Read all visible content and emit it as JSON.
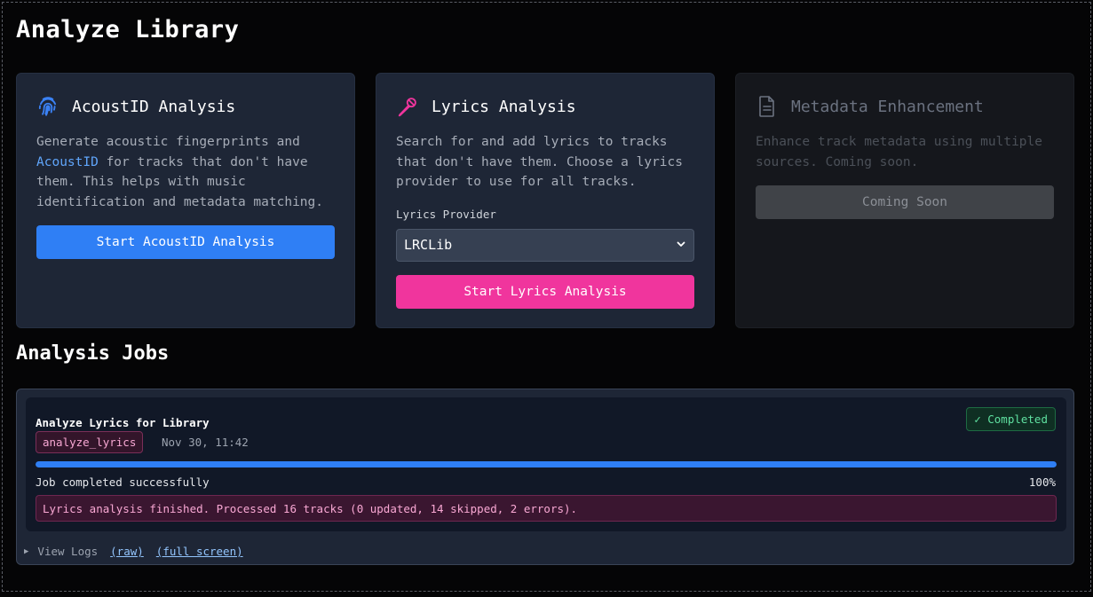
{
  "page": {
    "title": "Analyze Library"
  },
  "cards": {
    "acoustid": {
      "icon": "fingerprint-icon",
      "title": "AcoustID Analysis",
      "desc_before": "Generate acoustic fingerprints and ",
      "desc_highlight": "AcoustID",
      "desc_after": " for tracks that don't have them. This helps with music identification and metadata matching.",
      "button": "Start AcoustID Analysis"
    },
    "lyrics": {
      "icon": "microphone-icon",
      "title": "Lyrics Analysis",
      "desc": "Search for and add lyrics to tracks that don't have them. Choose a lyrics provider to use for all tracks.",
      "provider_label": "Lyrics Provider",
      "provider_value": "LRCLib",
      "button": "Start Lyrics Analysis"
    },
    "metadata": {
      "icon": "document-icon",
      "title": "Metadata Enhancement",
      "desc": "Enhance track metadata using multiple sources. Coming soon.",
      "button": "Coming Soon"
    }
  },
  "jobs": {
    "section_title": "Analysis Jobs",
    "items": [
      {
        "title": "Analyze Lyrics for Library",
        "status": "✓ Completed",
        "type": "analyze_lyrics",
        "time": "Nov 30, 11:42",
        "progress": 100,
        "message": "Job completed successfully",
        "percent": "100%",
        "result": "Lyrics analysis finished. Processed 16 tracks (0 updated, 14 skipped, 2 errors)."
      }
    ],
    "logs": {
      "toggle": "View Logs",
      "raw": "(raw)",
      "full": "(full screen)"
    }
  },
  "colors": {
    "accent_blue": "#2f7ff5",
    "accent_pink": "#f0359d",
    "success_green": "#5fe0a0"
  }
}
